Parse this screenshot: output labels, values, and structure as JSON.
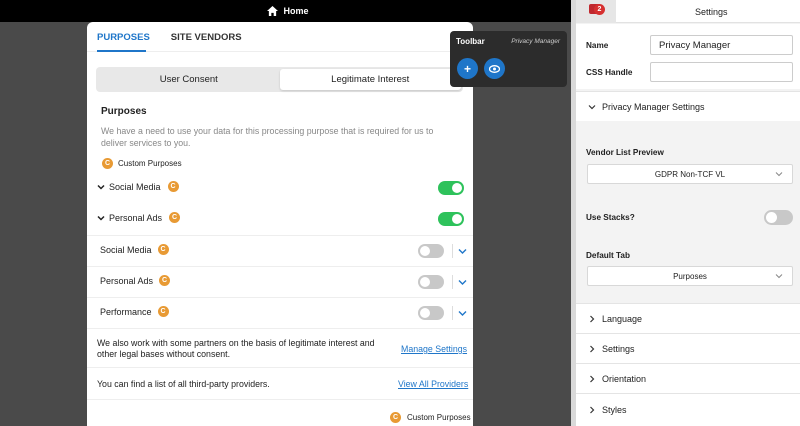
{
  "topbar": {
    "home_label": "Home"
  },
  "modal": {
    "tabs": [
      "PURPOSES",
      "SITE VENDORS"
    ],
    "segmented": [
      "User Consent",
      "Legitimate Interest"
    ],
    "purposes_title": "Purposes",
    "purposes_desc": "We have a need to use your data for this processing purpose that is required for us to deliver services to you.",
    "custom_purposes_label": "Custom Purposes",
    "badge_letter": "C",
    "groups": [
      {
        "label": "Social Media",
        "on": true
      },
      {
        "label": "Personal Ads",
        "on": true
      }
    ],
    "items": [
      {
        "label": "Social Media",
        "on": false
      },
      {
        "label": "Personal Ads",
        "on": false
      },
      {
        "label": "Performance",
        "on": false
      }
    ],
    "partners_text": "We also work with some partners on the basis of legitimate interest and other legal bases without consent.",
    "manage_settings": "Manage Settings",
    "list_text": "You can find a list of all third-party providers.",
    "view_all_providers": "View All Providers",
    "footer_custom_purposes": "Custom Purposes"
  },
  "toolbar": {
    "title": "Toolbar",
    "subtitle": "Privacy Manager",
    "add_label": "+"
  },
  "panel": {
    "title": "Settings",
    "notification_count": "2",
    "name_label": "Name",
    "name_value": "Privacy Manager",
    "css_handle_label": "CSS Handle",
    "css_handle_value": "",
    "pm_settings_label": "Privacy Manager Settings",
    "vendor_list_preview_label": "Vendor List Preview",
    "vendor_list_value": "GDPR Non-TCF VL",
    "use_stacks_label": "Use Stacks?",
    "use_stacks_on": false,
    "default_tab_label": "Default Tab",
    "default_tab_value": "Purposes",
    "sections": [
      "Language",
      "Settings",
      "Orientation",
      "Styles"
    ]
  },
  "colors": {
    "accent": "#1f76c9",
    "toggle_on": "#2ec25b",
    "badge": "#e89a34"
  }
}
